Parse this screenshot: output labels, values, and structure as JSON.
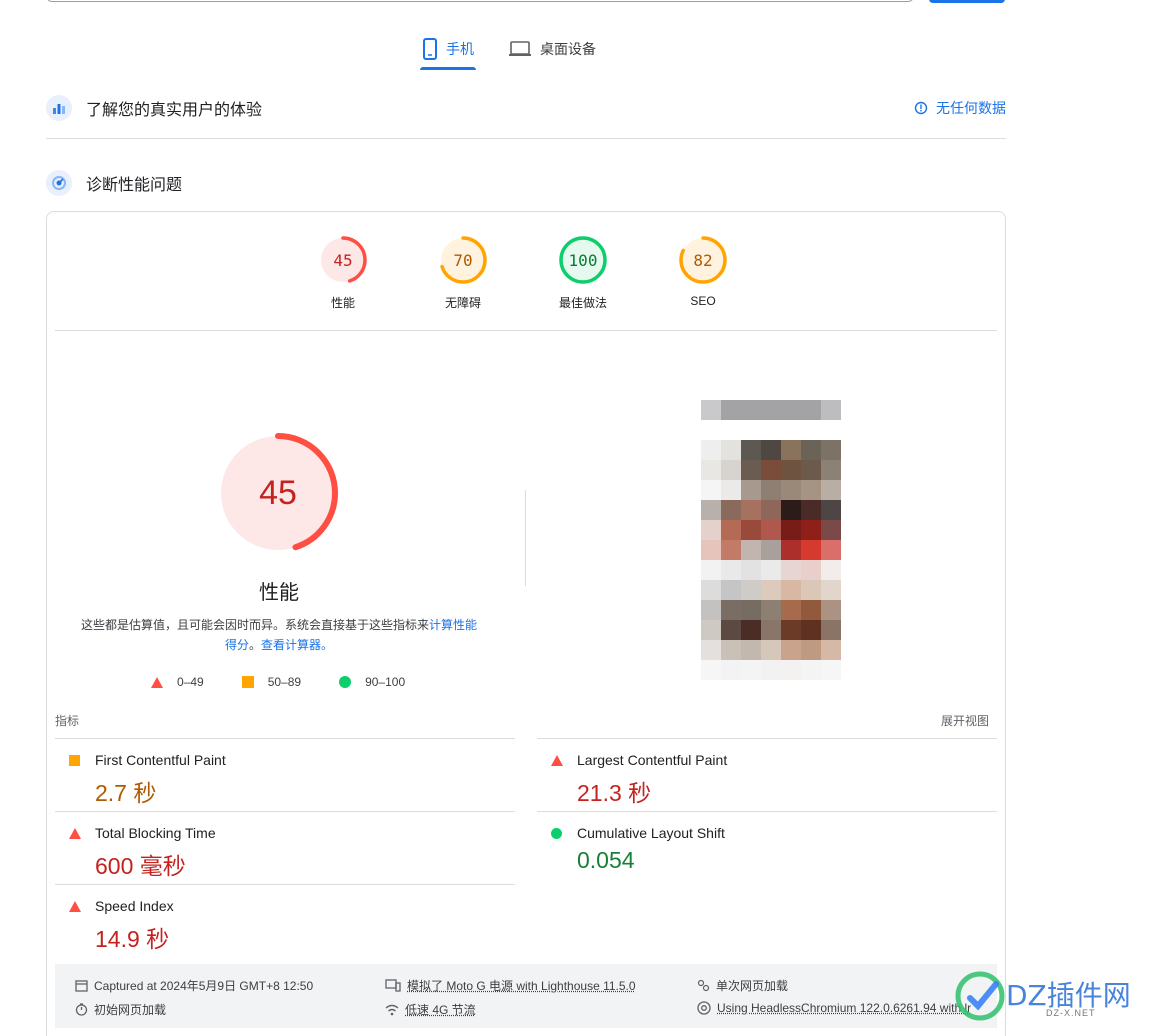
{
  "tabs": [
    {
      "label": "手机",
      "icon": "mobile-phone-icon",
      "active": true
    },
    {
      "label": "桌面设备",
      "icon": "laptop-icon",
      "active": false
    }
  ],
  "real_users": {
    "title": "了解您的真实用户的体验",
    "no_data": "无任何数据"
  },
  "diagnose": {
    "title": "诊断性能问题"
  },
  "scores": [
    {
      "label": "性能",
      "value": "45",
      "score": 45,
      "color": "#ff4e42"
    },
    {
      "label": "无障碍",
      "value": "70",
      "score": 70,
      "color": "#ffa400"
    },
    {
      "label": "最佳做法",
      "value": "100",
      "score": 100,
      "color": "#0cce6b"
    },
    {
      "label": "SEO",
      "value": "82",
      "score": 82,
      "color": "#ffa400"
    }
  ],
  "performance": {
    "score": "45",
    "score_value": 45,
    "title": "性能",
    "desc_prefix": "这些都是估算值，且可能会因时而异。系统会直接基于这些指标来",
    "desc_link1": "计算性能得分",
    "desc_mid": "。",
    "desc_link2": "查看计算器。"
  },
  "legend": [
    {
      "range": "0–49",
      "shape": "triangle",
      "color": "#ff4e42"
    },
    {
      "range": "50–89",
      "shape": "square",
      "color": "#ffa400"
    },
    {
      "range": "90–100",
      "shape": "circle",
      "color": "#0cce6b"
    }
  ],
  "metrics_header": {
    "label": "指标",
    "expand": "展开视图"
  },
  "metrics": [
    {
      "name": "First Contentful Paint",
      "value": "2.7 秒",
      "status": "average"
    },
    {
      "name": "Largest Contentful Paint",
      "value": "21.3 秒",
      "status": "fail"
    },
    {
      "name": "Total Blocking Time",
      "value": "600 毫秒",
      "status": "fail"
    },
    {
      "name": "Cumulative Layout Shift",
      "value": "0.054",
      "status": "pass"
    },
    {
      "name": "Speed Index",
      "value": "14.9 秒",
      "status": "fail"
    }
  ],
  "footer": {
    "captured": "Captured at 2024年5月9日 GMT+8 12:50",
    "device": "模拟了 Moto G 电源 with Lighthouse 11.5.0",
    "single_load": "单次网页加载",
    "initial_load": "初始网页加载",
    "network": "低速 4G 节流",
    "browser": "Using HeadlessChromium 122.0.6261.94 with lr"
  },
  "watermark": {
    "brand": "DZ插件网",
    "url": "DZ-X.NET"
  }
}
